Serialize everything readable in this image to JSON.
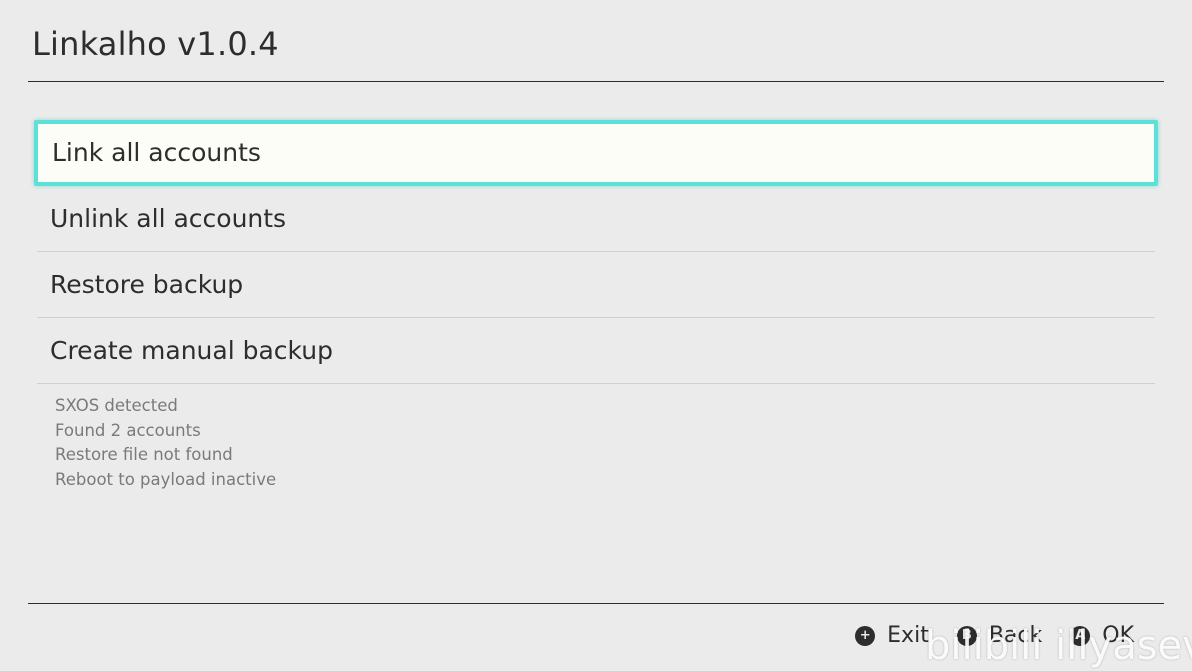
{
  "app": {
    "title": "Linkalho v1.0.4"
  },
  "menu": {
    "items": [
      {
        "label": "Link all accounts",
        "selected": true
      },
      {
        "label": "Unlink all accounts",
        "selected": false
      },
      {
        "label": "Restore backup",
        "selected": false
      },
      {
        "label": "Create manual backup",
        "selected": false
      }
    ]
  },
  "status": {
    "lines": [
      "SXOS detected",
      "Found 2 accounts",
      "Restore file not found",
      "Reboot to payload inactive"
    ]
  },
  "footer": {
    "exit": {
      "glyph": "+",
      "label": "Exit",
      "icon": "plus-button-icon"
    },
    "back": {
      "glyph": "B",
      "label": "Back",
      "icon": "b-button-icon"
    },
    "ok": {
      "glyph": "A",
      "label": "OK",
      "icon": "a-button-icon"
    }
  },
  "watermark": {
    "text": "bilibili illyasever"
  },
  "colors": {
    "background": "#ebebeb",
    "text": "#2d2d2d",
    "selection_border": "#5ce1d8",
    "status_text": "#7a7a7a"
  }
}
